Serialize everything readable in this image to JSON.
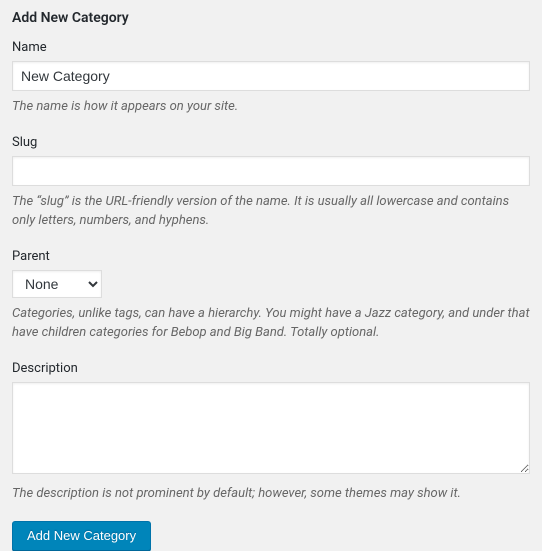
{
  "heading": "Add New Category",
  "fields": {
    "name": {
      "label": "Name",
      "value": "New Category",
      "help": "The name is how it appears on your site."
    },
    "slug": {
      "label": "Slug",
      "value": "",
      "help": "The “slug” is the URL-friendly version of the name. It is usually all lowercase and contains only letters, numbers, and hyphens."
    },
    "parent": {
      "label": "Parent",
      "selected": "None",
      "help": "Categories, unlike tags, can have a hierarchy. You might have a Jazz category, and under that have children categories for Bebop and Big Band. Totally optional."
    },
    "description": {
      "label": "Description",
      "value": "",
      "help": "The description is not prominent by default; however, some themes may show it."
    }
  },
  "submit": {
    "label": "Add New Category"
  }
}
